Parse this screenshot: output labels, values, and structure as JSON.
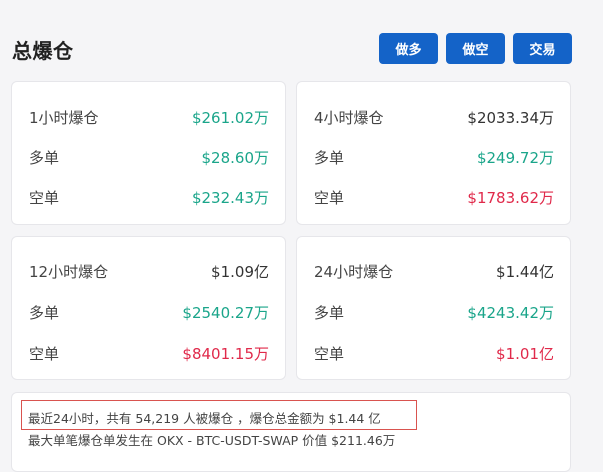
{
  "header": {
    "title": "总爆仓",
    "buttons": [
      "做多",
      "做空",
      "交易"
    ]
  },
  "cards": [
    {
      "rows": [
        {
          "label": "1小时爆仓",
          "value": "$261.02万",
          "color": "#1aa58a"
        },
        {
          "label": "多单",
          "value": "$28.60万",
          "color": "#1aa58a"
        },
        {
          "label": "空单",
          "value": "$232.43万",
          "color": "#1aa58a"
        }
      ]
    },
    {
      "rows": [
        {
          "label": "4小时爆仓",
          "value": "$2033.34万",
          "color": "#333333"
        },
        {
          "label": "多单",
          "value": "$249.72万",
          "color": "#1aa58a"
        },
        {
          "label": "空单",
          "value": "$1783.62万",
          "color": "#e0294a"
        }
      ]
    },
    {
      "rows": [
        {
          "label": "12小时爆仓",
          "value": "$1.09亿",
          "color": "#333333"
        },
        {
          "label": "多单",
          "value": "$2540.27万",
          "color": "#1aa58a"
        },
        {
          "label": "空单",
          "value": "$8401.15万",
          "color": "#e0294a"
        }
      ]
    },
    {
      "rows": [
        {
          "label": "24小时爆仓",
          "value": "$1.44亿",
          "color": "#333333"
        },
        {
          "label": "多单",
          "value": "$4243.42万",
          "color": "#1aa58a"
        },
        {
          "label": "空单",
          "value": "$1.01亿",
          "color": "#e0294a"
        }
      ]
    }
  ],
  "summary": {
    "line1": "最近24小时，共有 54,219 人被爆仓 ，爆仓总金额为 $1.44 亿",
    "line2": "最大单笔爆仓单发生在 OKX - BTC-USDT-SWAP 价值 $211.46万"
  },
  "colors": {
    "button": "#1463c8",
    "green": "#1aa58a",
    "red": "#e0294a",
    "highlight_border": "#d9534f"
  }
}
